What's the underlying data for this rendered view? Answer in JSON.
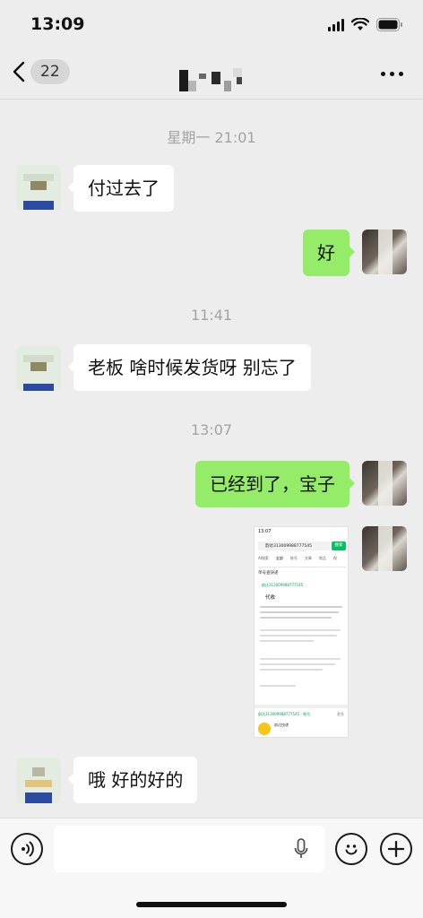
{
  "status_bar": {
    "time": "13:09"
  },
  "nav": {
    "unread_count": "22"
  },
  "chat": {
    "time_labels": [
      "星期一 21:01",
      "11:41",
      "13:07"
    ],
    "messages": [
      {
        "side": "left",
        "text": "付过去了"
      },
      {
        "side": "right",
        "text": "好"
      },
      {
        "side": "left",
        "text": "老板 啥时候发货呀 别忘了"
      },
      {
        "side": "right",
        "text": "已经到了，宝子"
      },
      {
        "side": "right",
        "type": "image"
      },
      {
        "side": "left",
        "text": "哦 好的好的"
      }
    ]
  },
  "screenshot": {
    "time": "13:07",
    "search_query": "韵达313009988777545",
    "search_button": "搜索",
    "tabs": [
      "AI搜索",
      "全部",
      "账号",
      "文章",
      "商品",
      "视"
    ],
    "section_title": "单号查快递",
    "tracking_no": "韵达313009988777545",
    "status": "代收",
    "footer_item": "韵达313009988777545 - 账号",
    "footer_more": "更多",
    "service_name": "韵达快递"
  },
  "colors": {
    "bubble_right": "#95ec69",
    "bubble_left": "#ffffff",
    "background": "#ededed"
  }
}
